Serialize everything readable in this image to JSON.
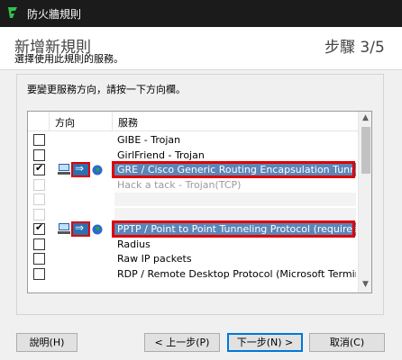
{
  "window": {
    "title": "防火牆規則"
  },
  "header": {
    "heading": "新增新規則",
    "step": "步驟 3/5",
    "subheading": "選擇使用此規則的服務。"
  },
  "instruction": "要變更服務方向，請按一下方向欄。",
  "columns": {
    "direction": "方向",
    "service": "服務"
  },
  "rows": [
    {
      "checked": false,
      "service": "GIBE - Trojan",
      "direction_icons": false,
      "faded": false,
      "highlight": false
    },
    {
      "checked": false,
      "service": "GirlFriend - Trojan",
      "direction_icons": false,
      "faded": false,
      "highlight": false
    },
    {
      "checked": true,
      "service": "GRE / Cisco Generic Routing Encapsulation Tunnel",
      "direction_icons": true,
      "faded": false,
      "highlight": true
    },
    {
      "checked": false,
      "service": "Hack a tack - Trojan(TCP)",
      "direction_icons": false,
      "faded": true,
      "highlight": false
    },
    {
      "checked": false,
      "service": "",
      "direction_icons": false,
      "faded": true,
      "highlight": false
    },
    {
      "checked": false,
      "service": "",
      "direction_icons": false,
      "faded": true,
      "highlight": false
    },
    {
      "checked": true,
      "service": "PPTP / Point to Point Tunneling Protocol (requires al...",
      "direction_icons": true,
      "faded": false,
      "highlight": true
    },
    {
      "checked": false,
      "service": "Radius",
      "direction_icons": false,
      "faded": false,
      "highlight": false
    },
    {
      "checked": false,
      "service": "Raw IP packets",
      "direction_icons": false,
      "faded": false,
      "highlight": false
    },
    {
      "checked": false,
      "service": "RDP / Remote Desktop Protocol (Microsoft Terminal ...",
      "direction_icons": false,
      "faded": false,
      "highlight": false
    }
  ],
  "buttons": {
    "help": "說明(H)",
    "back": "< 上一步(P)",
    "next": "下一步(N) >",
    "cancel": "取消(C)"
  },
  "icons": {
    "app": "shield-icon",
    "computer": "computer-icon",
    "direction": "right-arrow-icon",
    "network": "globe-icon"
  },
  "colors": {
    "titlebar": "#1b1b1b",
    "selection": "#5b86b8",
    "highlight_outline": "#e00000",
    "app_icon": "#2fc24b"
  }
}
